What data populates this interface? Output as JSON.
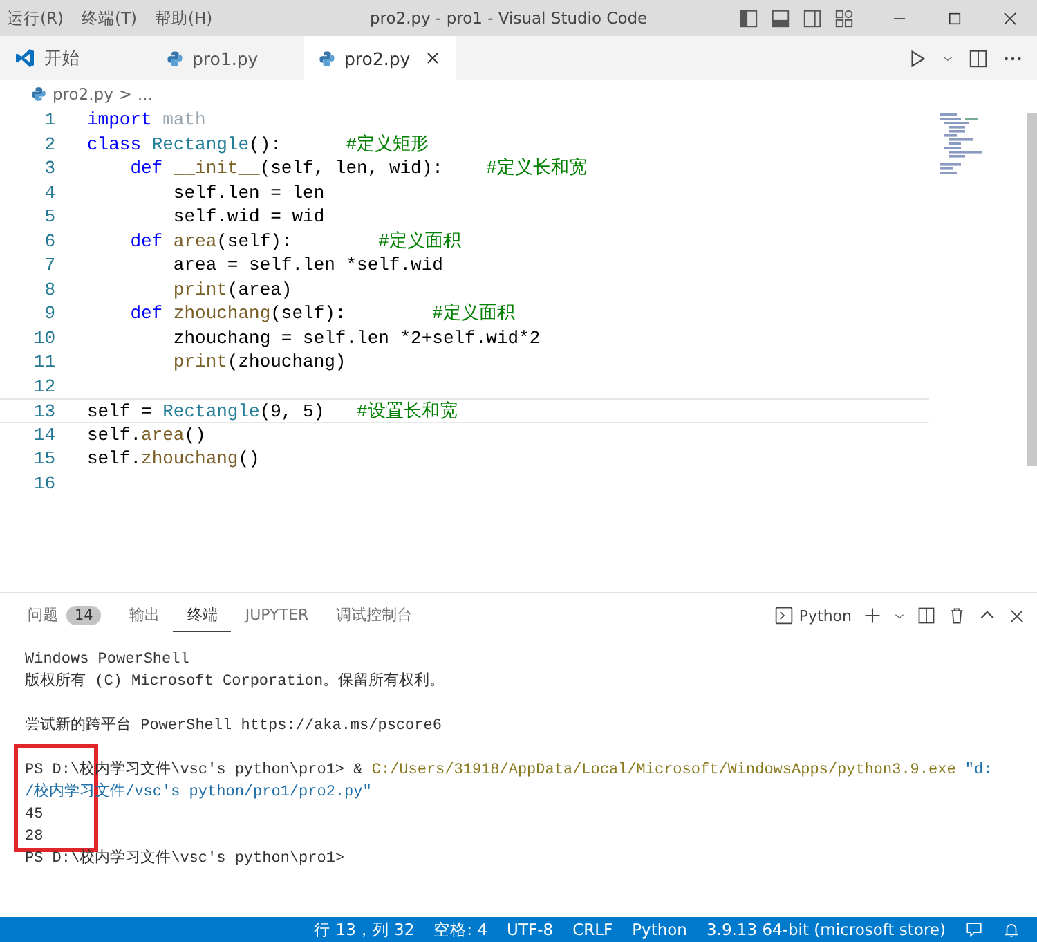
{
  "menu": [
    {
      "label": "运行(R)"
    },
    {
      "label": "终端(T)"
    },
    {
      "label": "帮助(H)"
    }
  ],
  "window": {
    "title": "pro2.py - pro1 - Visual Studio Code"
  },
  "tabs": [
    {
      "label": "开始",
      "kind": "welcome",
      "selected": false
    },
    {
      "label": "pro1.py",
      "kind": "python",
      "selected": false
    },
    {
      "label": "pro2.py",
      "kind": "python",
      "selected": true
    }
  ],
  "breadcrumb": {
    "file": "pro2.py",
    "separator": ">",
    "rest": "..."
  },
  "code_lines": [
    {
      "number": "1",
      "current": false,
      "tokens": [
        {
          "kind": "kw",
          "text": "import"
        },
        {
          "kind": "mod",
          "text": " math"
        }
      ]
    },
    {
      "number": "2",
      "current": false,
      "tokens": [
        {
          "kind": "kw",
          "text": "class"
        },
        {
          "kind": "cls",
          "text": " Rectangle"
        },
        {
          "kind": "tx",
          "text": "():      "
        },
        {
          "kind": "cm",
          "text": "#定义矩形"
        }
      ]
    },
    {
      "number": "3",
      "current": false,
      "tokens": [
        {
          "kind": "kw",
          "text": "    def"
        },
        {
          "kind": "fn",
          "text": " __init__"
        },
        {
          "kind": "tx",
          "text": "(self, len, wid):    "
        },
        {
          "kind": "cm",
          "text": "#定义长和宽"
        }
      ]
    },
    {
      "number": "4",
      "current": false,
      "tokens": [
        {
          "kind": "tx",
          "text": "        self.len = len"
        }
      ]
    },
    {
      "number": "5",
      "current": false,
      "tokens": [
        {
          "kind": "tx",
          "text": "        self.wid = wid"
        }
      ]
    },
    {
      "number": "6",
      "current": false,
      "tokens": [
        {
          "kind": "kw",
          "text": "    def"
        },
        {
          "kind": "fn",
          "text": " area"
        },
        {
          "kind": "tx",
          "text": "(self):        "
        },
        {
          "kind": "cm",
          "text": "#定义面积"
        }
      ]
    },
    {
      "number": "7",
      "current": false,
      "tokens": [
        {
          "kind": "tx",
          "text": "        area = self.len *self.wid"
        }
      ]
    },
    {
      "number": "8",
      "current": false,
      "tokens": [
        {
          "kind": "fn",
          "text": "        print"
        },
        {
          "kind": "tx",
          "text": "(area)"
        }
      ]
    },
    {
      "number": "9",
      "current": false,
      "tokens": [
        {
          "kind": "kw",
          "text": "    def"
        },
        {
          "kind": "fn",
          "text": " zhouchang"
        },
        {
          "kind": "tx",
          "text": "(self):        "
        },
        {
          "kind": "cm",
          "text": "#定义面积"
        }
      ]
    },
    {
      "number": "10",
      "current": false,
      "tokens": [
        {
          "kind": "tx",
          "text": "        zhouchang = self.len *2+self.wid*2"
        }
      ]
    },
    {
      "number": "11",
      "current": false,
      "tokens": [
        {
          "kind": "fn",
          "text": "        print"
        },
        {
          "kind": "tx",
          "text": "(zhouchang)"
        }
      ]
    },
    {
      "number": "12",
      "current": false
    },
    {
      "number": "13",
      "current": true,
      "tokens": [
        {
          "kind": "tx",
          "text": "self = "
        },
        {
          "kind": "cls",
          "text": "Rectangle"
        },
        {
          "kind": "tx",
          "text": "(9, 5)   "
        },
        {
          "kind": "cm",
          "text": "#设置长和宽"
        }
      ]
    },
    {
      "number": "14",
      "current": false,
      "tokens": [
        {
          "kind": "tx",
          "text": "self."
        },
        {
          "kind": "fn",
          "text": "area"
        },
        {
          "kind": "tx",
          "text": "()"
        }
      ]
    },
    {
      "number": "15",
      "current": false,
      "tokens": [
        {
          "kind": "tx",
          "text": "self."
        },
        {
          "kind": "fn",
          "text": "zhouchang"
        },
        {
          "kind": "tx",
          "text": "()"
        }
      ]
    },
    {
      "number": "16",
      "current": false
    }
  ],
  "panel_tabs": [
    {
      "label": "问题",
      "badge": "14",
      "selected": false
    },
    {
      "label": "输出",
      "selected": false
    },
    {
      "label": "终端",
      "selected": true
    },
    {
      "label": "JUPYTER",
      "selected": false
    },
    {
      "label": "调试控制台",
      "selected": false
    }
  ],
  "terminal_selector": {
    "label": "Python"
  },
  "terminal_blocks": [
    [
      [
        {
          "kind": "plain",
          "text": "Windows PowerShell"
        }
      ],
      [
        {
          "kind": "plain",
          "text": "版权所有 (C) Microsoft Corporation。保留所有权利。"
        }
      ]
    ],
    [
      [
        {
          "kind": "plain",
          "text": "尝试新的跨平台 PowerShell https://aka.ms/pscore6"
        }
      ]
    ],
    [
      [
        {
          "kind": "plain",
          "text": "PS D:\\校内学习文件\\vsc's python\\pro1> & "
        },
        {
          "kind": "command",
          "text": "C:/Users/31918/AppData/Local/Microsoft/WindowsApps/python3.9.exe"
        },
        {
          "kind": "string",
          "text": " \"d:"
        }
      ],
      [
        {
          "kind": "string",
          "text": "/校内学习文件/vsc's python/pro1/pro2.py\""
        }
      ],
      [
        {
          "kind": "plain",
          "text": "45"
        }
      ],
      [
        {
          "kind": "plain",
          "text": "28"
        }
      ],
      [
        {
          "kind": "plain",
          "text": "PS D:\\校内学习文件\\vsc's python\\pro1>"
        }
      ]
    ]
  ],
  "highlight_box": true,
  "status_items": [
    {
      "label": "行 13，列 32"
    },
    {
      "label": "空格: 4"
    },
    {
      "label": "UTF-8"
    },
    {
      "label": "CRLF"
    },
    {
      "label": "Python"
    },
    {
      "label": "3.9.13 64-bit (microsoft store)"
    }
  ]
}
